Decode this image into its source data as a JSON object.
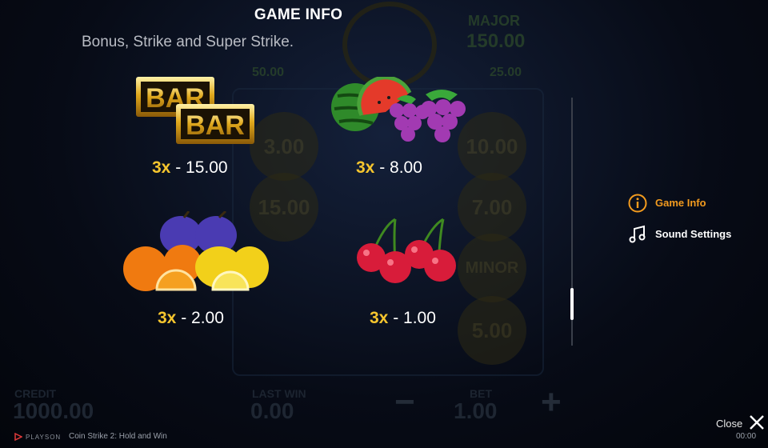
{
  "background": {
    "jackpots": {
      "major_label": "MAJOR",
      "major_value": "150.00",
      "minor_value": "25.00",
      "left_small_value": "50.00"
    },
    "coins": [
      "3.00",
      "15.00",
      "10.00",
      "7.00",
      "MINOR",
      "5.00"
    ],
    "credit_label": "CREDIT",
    "credit_value": "1000.00",
    "last_win_label": "LAST WIN",
    "last_win_value": "0.00",
    "bet_label": "BET",
    "bet_value": "1.00",
    "minus": "−",
    "plus": "+"
  },
  "panel": {
    "title": "GAME INFO",
    "subtitle": "Bonus, Strike and Super Strike.",
    "paytable": [
      {
        "symbol": "bar-bar",
        "bar_text": "BAR",
        "multiplier": "3x",
        "payout": " - 15.00"
      },
      {
        "symbol": "watermelon-grapes",
        "multiplier": "3x",
        "payout": " - 8.00"
      },
      {
        "symbol": "oranges-plums-lemons",
        "multiplier": "3x",
        "payout": " - 2.00"
      },
      {
        "symbol": "cherries",
        "multiplier": "3x",
        "payout": " - 1.00"
      }
    ]
  },
  "menu": {
    "game_info": "Game Info",
    "sound_settings": "Sound Settings"
  },
  "close_label": "Close",
  "footer": {
    "brand": "PLAYSON",
    "game_name": "Coin Strike 2: Hold and Win",
    "time": "00:00"
  },
  "colors": {
    "accent": "#f39b1e",
    "multiplier": "#f5c52e"
  }
}
